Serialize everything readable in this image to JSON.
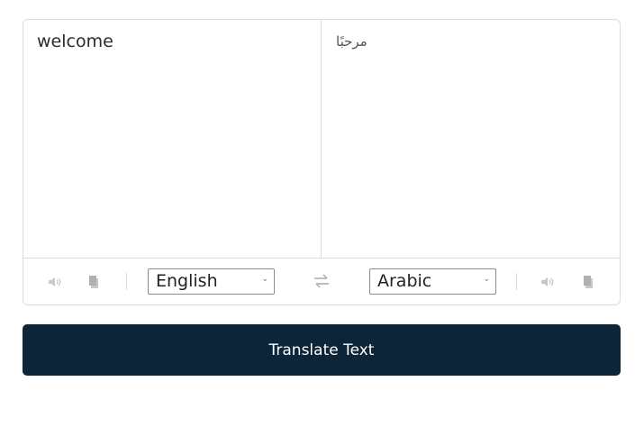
{
  "from": {
    "text": "welcome",
    "language": "English"
  },
  "to": {
    "text": "مرحبًا",
    "language": "Arabic"
  },
  "icons": {
    "speak_from": "speaker-icon",
    "copy_from": "copy-icon",
    "exchange": "exchange-arrows-icon",
    "speak_to": "speaker-icon",
    "copy_to": "copy-icon"
  },
  "button": {
    "label": "Translate Text"
  },
  "colors": {
    "button_bg": "#0c2538",
    "border": "#dcdcdc",
    "icon": "#c8c8c8"
  }
}
